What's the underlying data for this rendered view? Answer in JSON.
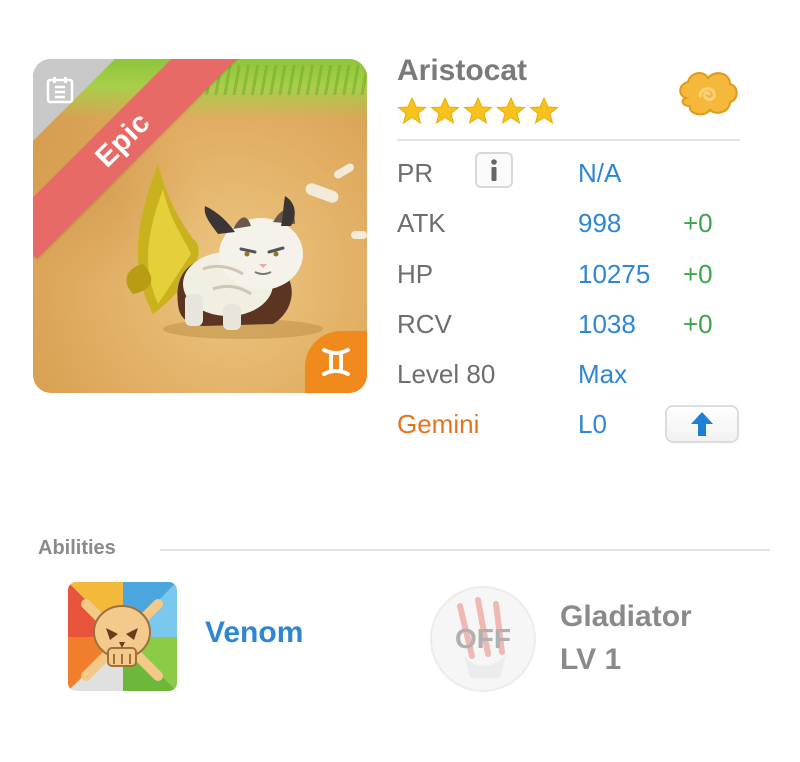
{
  "pet": {
    "name": "Aristocat",
    "rarity": "Epic",
    "star_count": 5,
    "zodiac_icon": "gemini-icon"
  },
  "stats": {
    "pr_label": "PR",
    "pr_value": "N/A",
    "atk_label": "ATK",
    "atk_value": "998",
    "atk_bonus": "+0",
    "hp_label": "HP",
    "hp_value": "10275",
    "hp_bonus": "+0",
    "rcv_label": "RCV",
    "rcv_value": "1038",
    "rcv_bonus": "+0",
    "level_label": "Level 80",
    "level_value": "Max",
    "zodiac_label": "Gemini",
    "zodiac_value": "L0"
  },
  "abilities": {
    "title": "Abilities",
    "items": [
      {
        "name": "Venom",
        "icon": "skull-icon"
      },
      {
        "status": "OFF",
        "name": "Gladiator",
        "level": "LV 1",
        "icon": "claw-icon"
      }
    ]
  },
  "colors": {
    "value_blue": "#2e86d4",
    "bonus_green": "#3ca54a",
    "zodiac_orange": "#e8731a",
    "epic_red": "#e86a66",
    "star_yellow": "#f7c21c"
  }
}
